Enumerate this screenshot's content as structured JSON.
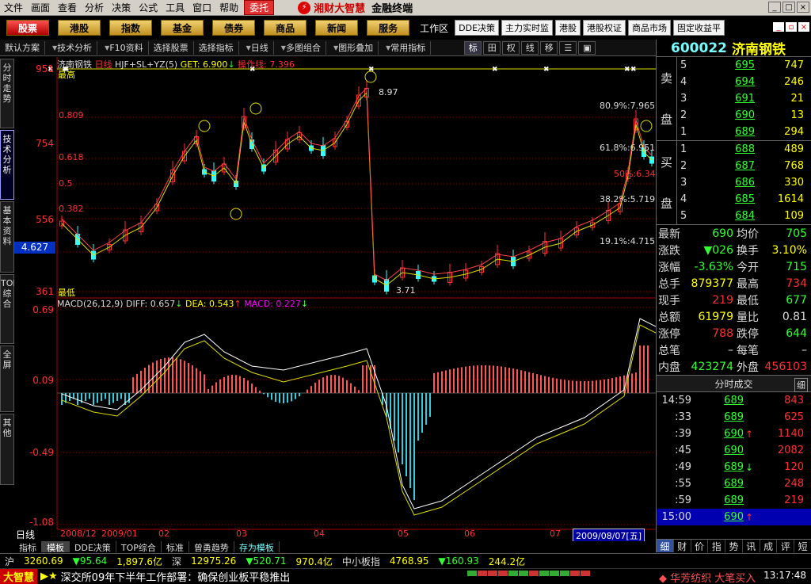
{
  "menu": {
    "items": [
      "文件",
      "画面",
      "查看",
      "分析",
      "决策",
      "公式",
      "工具",
      "窗口",
      "帮助"
    ],
    "entrust": "委托",
    "brand": "湘财大智慧",
    "brand_sub": "金融终端"
  },
  "nav": {
    "buttons": [
      "股票",
      "港股",
      "指数",
      "基金",
      "债券",
      "商品",
      "新闻",
      "服务"
    ],
    "workarea": "工作区",
    "small": [
      "DDE决策",
      "主力实时监",
      "港股",
      "港股权证",
      "商品市场",
      "固定收益平"
    ]
  },
  "toolbar": {
    "items": [
      "默认方案",
      "技术分析",
      "F10资料",
      "选择股票",
      "选择指标",
      "日线",
      "多图组合",
      "图形叠加",
      "常用指标"
    ],
    "icons": [
      "标",
      "田",
      "权",
      "线",
      "移",
      "☰",
      "▣"
    ]
  },
  "left_tabs": [
    "分时走势",
    "技术分析",
    "基本资料",
    "TOP综合",
    "全屏",
    "其他"
  ],
  "price_panel": {
    "name": "济南钢铁",
    "period": "日线",
    "indicator": "HJF+SL+YZ(5)",
    "get_label": "GET:",
    "get_value": "6.900",
    "get_arrow": "↓",
    "op_label": "操作线:",
    "op_value": "7.396",
    "cur_price": "4.627",
    "y_labels": [
      "951",
      "754",
      "556",
      "361"
    ],
    "top_label": "最高",
    "bottom_label": "最低",
    "fib": [
      "0.809",
      "0.618",
      "0.5",
      "0.382"
    ],
    "right_fib": [
      "80.9%:7.965",
      "61.8%:6.951",
      "50%:6.34",
      "38.2%:5.719",
      "19.1%:4.715"
    ],
    "annot_high": "8.97",
    "annot_low": "3.71"
  },
  "macd_panel": {
    "label": "MACD(26,12,9)",
    "diff_label": "DIFF:",
    "diff": "0.657",
    "diff_arrow": "↓",
    "dea_label": "DEA:",
    "dea": "0.543",
    "dea_arrow": "↑",
    "macd_label": "MACD:",
    "macd": "0.227",
    "macd_arrow": "↓",
    "y_labels": [
      "0.69",
      "0.09",
      "-0.49",
      "-1.08"
    ]
  },
  "dates": {
    "labels": [
      "2008/12",
      "2009/01",
      "02",
      "03",
      "04",
      "05",
      "06",
      "07"
    ],
    "current": "2009/08/07[五]",
    "period": "日线"
  },
  "bottom_tabs": [
    "指标",
    "模板",
    "DDE决策",
    "TOP综合",
    "标准",
    "曾勇趋势",
    "存为模板"
  ],
  "stock": {
    "code": "600022",
    "name": "济南钢铁"
  },
  "orderbook": {
    "sell_label": [
      "卖",
      "盘"
    ],
    "buy_label": [
      "买",
      "盘"
    ],
    "sell": [
      {
        "lv": "5",
        "price": "695",
        "vol": "747"
      },
      {
        "lv": "4",
        "price": "694",
        "vol": "246"
      },
      {
        "lv": "3",
        "price": "691",
        "vol": "21"
      },
      {
        "lv": "2",
        "price": "690",
        "vol": "13"
      },
      {
        "lv": "1",
        "price": "689",
        "vol": "294"
      }
    ],
    "buy": [
      {
        "lv": "1",
        "price": "688",
        "vol": "489"
      },
      {
        "lv": "2",
        "price": "687",
        "vol": "768"
      },
      {
        "lv": "3",
        "price": "686",
        "vol": "330"
      },
      {
        "lv": "4",
        "price": "685",
        "vol": "1614"
      },
      {
        "lv": "5",
        "price": "684",
        "vol": "109"
      }
    ]
  },
  "stats": [
    {
      "k": "最新",
      "v": "690",
      "vc": "grn",
      "k2": "均价",
      "v2": "705",
      "v2c": "grn"
    },
    {
      "k": "涨跌",
      "v": "▼026",
      "vc": "grn",
      "k2": "换手",
      "v2": "3.10%",
      "v2c": "yel"
    },
    {
      "k": "涨幅",
      "v": "-3.63%",
      "vc": "grn",
      "k2": "今开",
      "v2": "715",
      "v2c": "grn"
    },
    {
      "k": "总手",
      "v": "879377",
      "vc": "yel",
      "k2": "最高",
      "v2": "734",
      "v2c": "red"
    },
    {
      "k": "现手",
      "v": "219",
      "vc": "red",
      "k2": "最低",
      "v2": "677",
      "v2c": "grn"
    },
    {
      "k": "总额",
      "v": "61979",
      "vc": "yel",
      "k2": "量比",
      "v2": "0.81",
      "v2c": "wht"
    },
    {
      "k": "涨停",
      "v": "788",
      "vc": "red",
      "k2": "跌停",
      "v2": "644",
      "v2c": "grn"
    },
    {
      "k": "总笔",
      "v": "–",
      "vc": "wht",
      "k2": "每笔",
      "v2": "–",
      "v2c": "wht"
    },
    {
      "k": "内盘",
      "v": "423274",
      "vc": "grn",
      "k2": "外盘",
      "v2": "456103",
      "v2c": "red"
    }
  ],
  "ticks_title": "分时成交",
  "ticks_icon": "细",
  "ticks": [
    {
      "t": "14:59",
      "p": "689",
      "a": "",
      "v": "843"
    },
    {
      "t": ":33",
      "p": "689",
      "a": "",
      "v": "625"
    },
    {
      "t": ":39",
      "p": "690",
      "a": "↑",
      "v": "1140"
    },
    {
      "t": ":45",
      "p": "690",
      "a": "",
      "v": "2082"
    },
    {
      "t": ":49",
      "p": "689",
      "a": "↓",
      "v": "120"
    },
    {
      "t": ":55",
      "p": "689",
      "a": "",
      "v": "248"
    },
    {
      "t": ":59",
      "p": "689",
      "a": "",
      "v": "219"
    },
    {
      "t": "15:00",
      "p": "690",
      "a": "↑",
      "v": ""
    }
  ],
  "rp_tabs": [
    "细",
    "财",
    "价",
    "指",
    "势",
    "讯",
    "成",
    "评",
    "短"
  ],
  "status1": {
    "sh_label": "沪",
    "sh_index": "3260.69",
    "sh_change": "▼95.64",
    "sh_amount": "1,897.6亿",
    "sz_label": "深",
    "sz_index": "12975.26",
    "sz_change": "▼520.71",
    "sz_amount": "970.4亿",
    "sme_label": "中小板指",
    "sme_index": "4768.95",
    "sme_change": "▼160.93",
    "sme_amount": "244.2亿"
  },
  "status2": {
    "app": "大智慧",
    "news": "深交所09年下半年工作部署：确保创业板平稳推出",
    "alert": "◆ 华芳纺织 大笔买入",
    "time": "13:17:48"
  },
  "chart_data": {
    "type": "candlestick",
    "series": [
      {
        "name": "MACD(26,12,9)",
        "values": [
          0.657,
          0.543,
          0.227
        ]
      }
    ],
    "x": [
      "2008/12",
      "2009/01",
      "02",
      "03",
      "04",
      "05",
      "06",
      "07",
      "2009/08/07"
    ],
    "ylim": [
      3.61,
      9.51
    ]
  }
}
